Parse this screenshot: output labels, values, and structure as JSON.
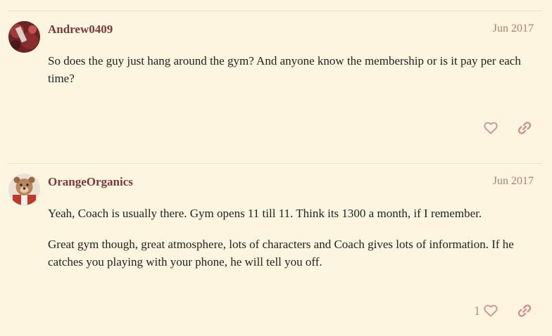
{
  "posts": [
    {
      "username": "Andrew0409",
      "date": "Jun 2017",
      "paragraphs": [
        "So does the guy just hang around the gym? And anyone know the membership or is it pay per each time?"
      ],
      "like_count": ""
    },
    {
      "username": "OrangeOrganics",
      "date": "Jun 2017",
      "paragraphs": [
        "Yeah, Coach is usually there. Gym opens 11 till 11. Think its 1300 a month, if I remember.",
        "Great gym though, great atmosphere, lots of characters and Coach gives lots of information. If he catches you playing with your phone, he will tell you off."
      ],
      "like_count": "1"
    }
  ],
  "icons": {
    "like": "heart-icon",
    "share": "link-icon"
  },
  "colors": {
    "background": "#fdf5df",
    "username": "#7a3a3a",
    "date": "#b57d6a",
    "icon": "#c9928a"
  }
}
